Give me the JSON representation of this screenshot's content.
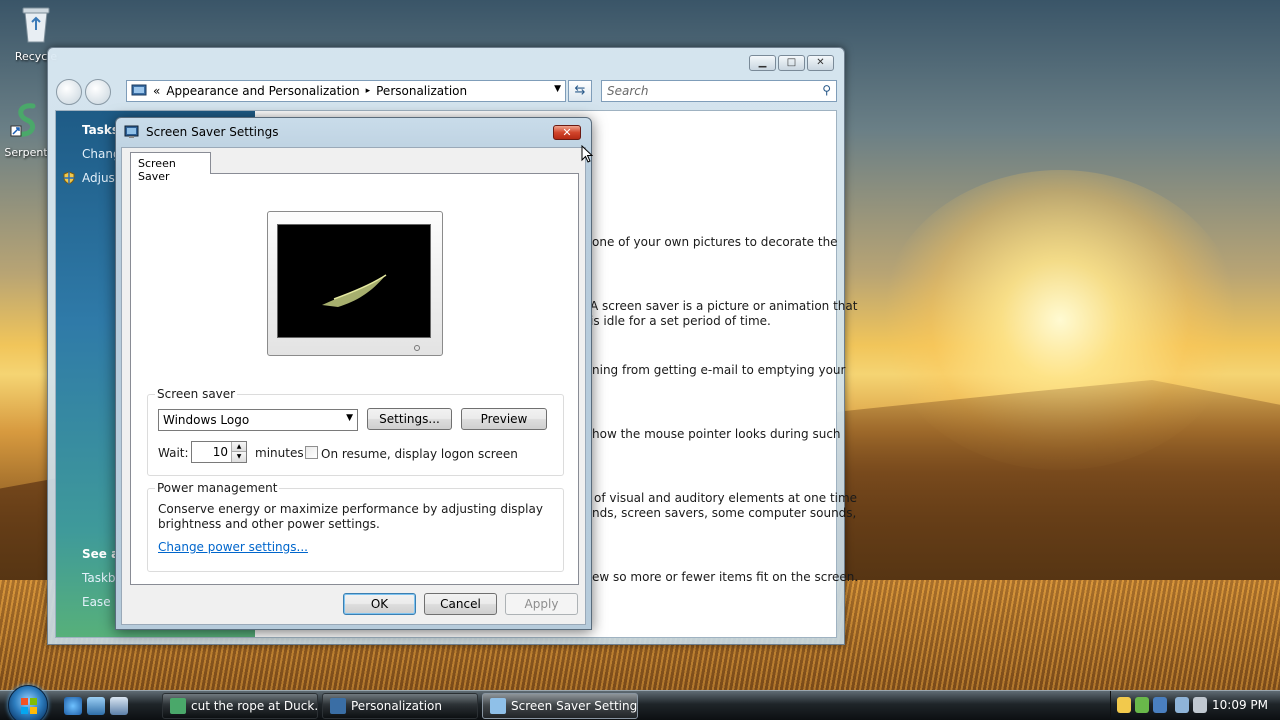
{
  "desktop": {
    "icons": [
      {
        "label": "Recycle",
        "icon": "recycle-bin-icon"
      },
      {
        "label": "Serpent",
        "icon": "serpent-app-icon"
      }
    ]
  },
  "explorer": {
    "breadcrumb": {
      "chevrons": "«",
      "item1": "Appearance and Personalization",
      "sep": "▸",
      "item2": "Personalization"
    },
    "search_placeholder": "Search",
    "tasks": {
      "header": "Tasks",
      "links": [
        "Chang",
        "Adjust"
      ],
      "bottom_header": "See al",
      "bottom_links": [
        "Taskb",
        "Ease o"
      ]
    },
    "content_fragments": [
      "one of your own pictures to decorate the",
      "A screen saver is a picture or animation that",
      "is idle for a set period of time.",
      "ning from getting e-mail to emptying your",
      "how the mouse pointer looks during such",
      "of visual and auditory elements at one time",
      "nds, screen savers, some computer sounds,",
      "ew so more or fewer items fit on the screen."
    ]
  },
  "dialog": {
    "title": "Screen Saver Settings",
    "tab": "Screen Saver",
    "screen_saver_group": "Screen saver",
    "selected_saver": "Windows Logo",
    "settings_button": "Settings...",
    "preview_button": "Preview",
    "wait_label": "Wait:",
    "wait_value": "10",
    "minutes_label": "minutes",
    "resume_checkbox": "On resume, display logon screen",
    "resume_checked": false,
    "power_group": "Power management",
    "power_text_1": "Conserve energy or maximize performance by adjusting display",
    "power_text_2": "brightness and other power settings.",
    "power_link": "Change power settings...",
    "ok": "OK",
    "cancel": "Cancel",
    "apply": "Apply"
  },
  "taskbar": {
    "buttons": [
      {
        "label": "cut the rope at Duck...",
        "icon": "serpent-app-icon",
        "active": false
      },
      {
        "label": "Personalization",
        "icon": "control-panel-icon",
        "active": false
      },
      {
        "label": "Screen Saver Settings",
        "icon": "screensaver-icon",
        "active": true
      }
    ],
    "clock": "10:09 PM"
  },
  "colors": {
    "link": "#0066cc",
    "close_button": "#c8412a",
    "tasks_pane": "#2f7aa8"
  }
}
